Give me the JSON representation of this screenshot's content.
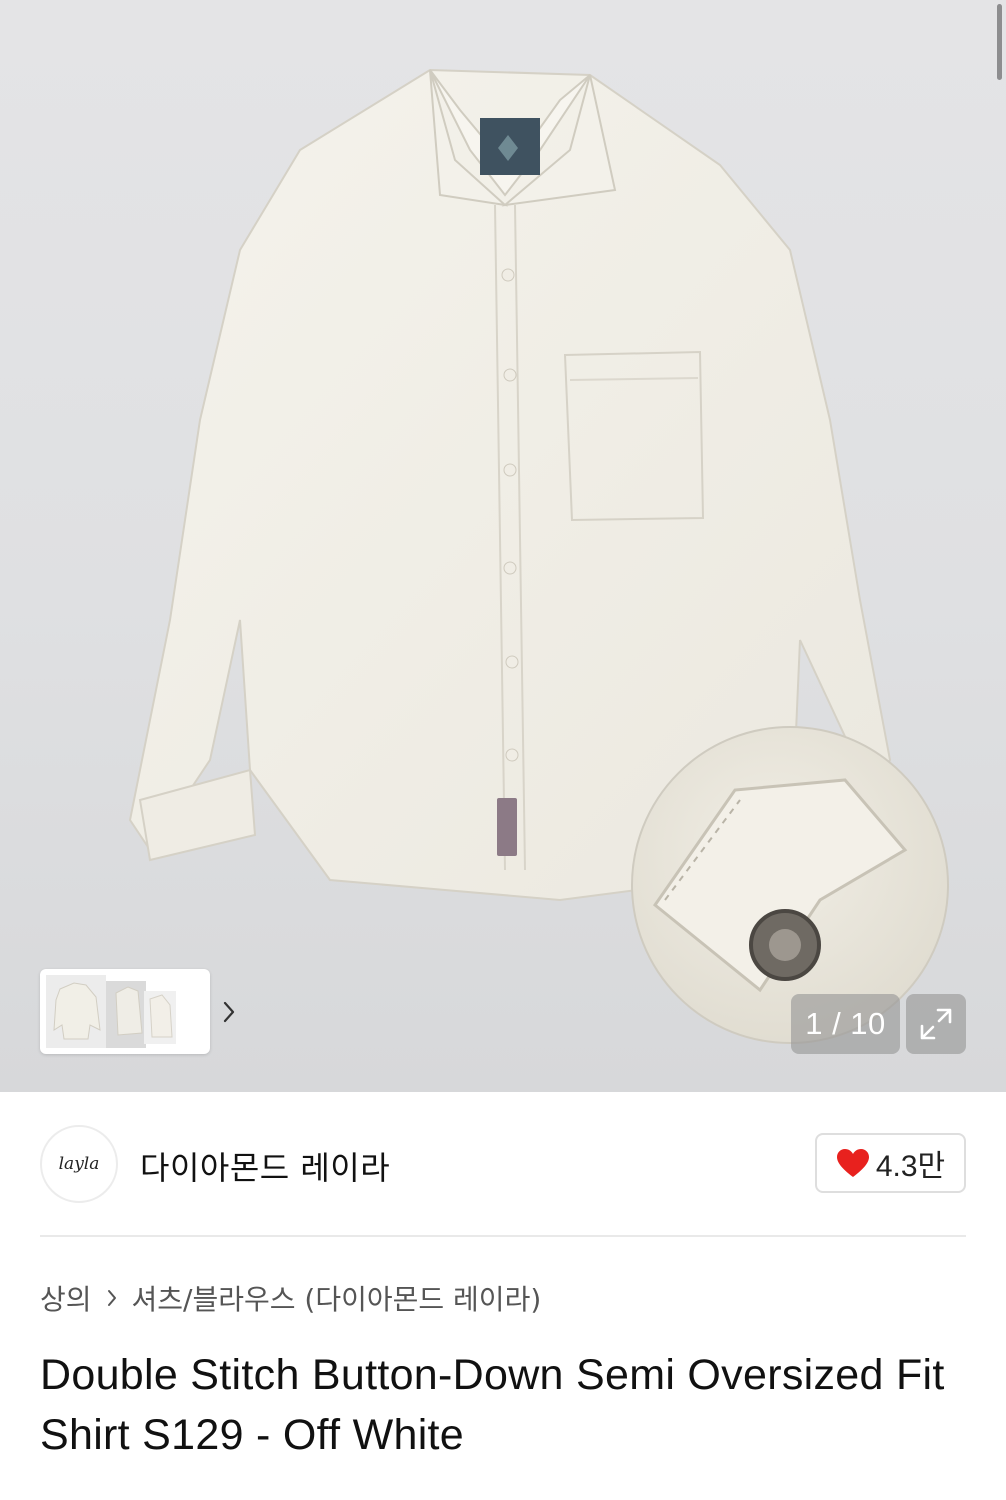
{
  "gallery": {
    "counter": "1 / 10",
    "thumbnail_count": 3,
    "icons": {
      "next": "chevron-right-icon",
      "expand": "expand-arrows-icon"
    }
  },
  "brand": {
    "logo_text": "layla",
    "name": "다이아몬드 레이라",
    "like_count": "4.3만",
    "like_icon": "heart-icon",
    "like_color": "#e8211e"
  },
  "breadcrumb": {
    "level1": "상의",
    "separator_icon": "chevron-right-icon",
    "level2": "셔츠/블라우스 (다이아몬드 레이라)"
  },
  "product": {
    "title": "Double Stitch Button-Down Semi Oversized Fit Shirt S129 - Off White"
  }
}
